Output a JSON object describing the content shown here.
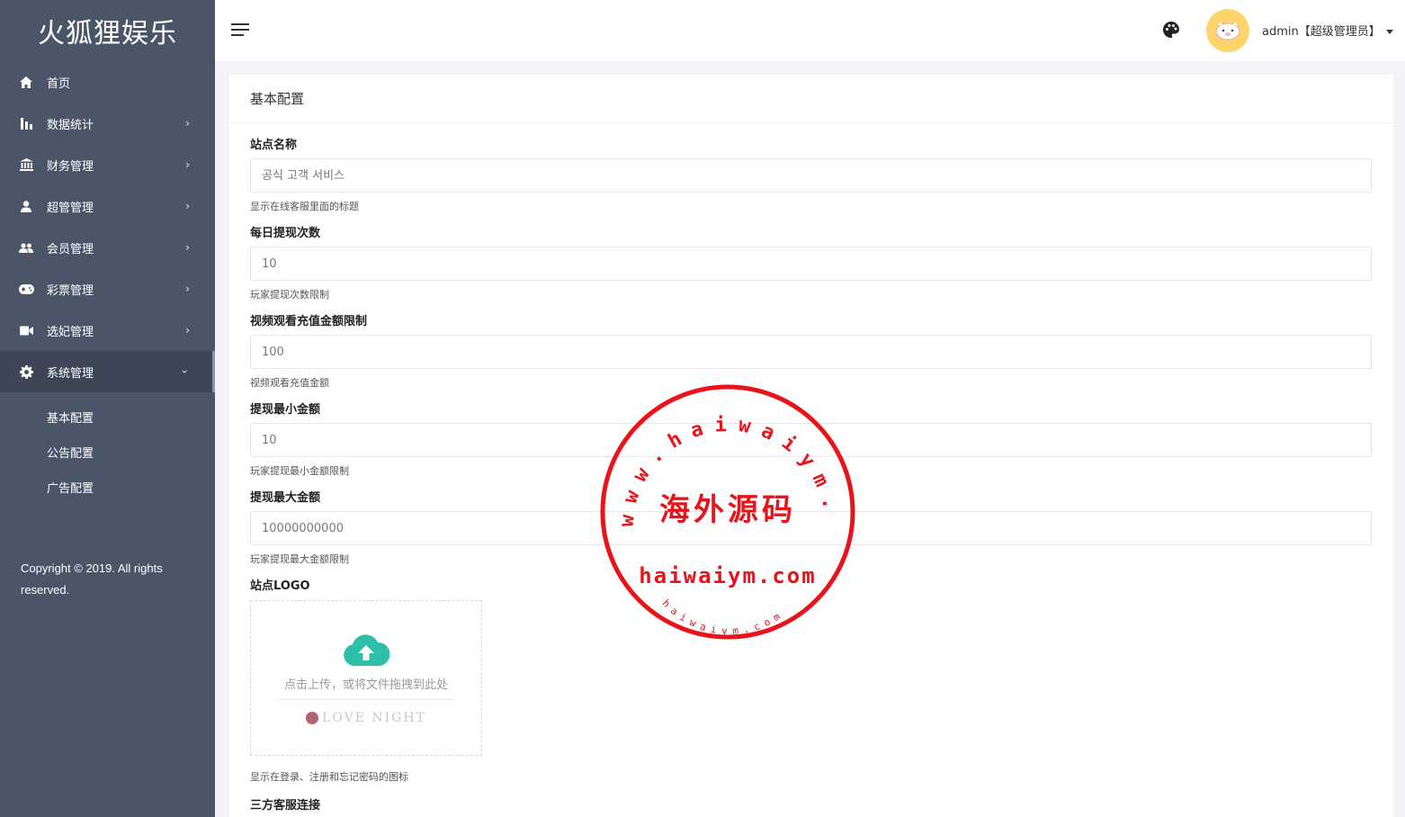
{
  "brand": {
    "title": "火狐狸娱乐"
  },
  "sidebar": {
    "items": [
      {
        "label": "首页",
        "icon": "home-icon",
        "has_children": false
      },
      {
        "label": "数据统计",
        "icon": "bar-chart-icon",
        "has_children": true
      },
      {
        "label": "财务管理",
        "icon": "bank-icon",
        "has_children": true
      },
      {
        "label": "超管管理",
        "icon": "user-icon",
        "has_children": true
      },
      {
        "label": "会员管理",
        "icon": "users-icon",
        "has_children": true
      },
      {
        "label": "彩票管理",
        "icon": "gamepad-icon",
        "has_children": true
      },
      {
        "label": "选妃管理",
        "icon": "video-camera-icon",
        "has_children": true
      },
      {
        "label": "系统管理",
        "icon": "gear-icon",
        "has_children": true,
        "expanded": true
      }
    ],
    "submenu": [
      {
        "label": "基本配置"
      },
      {
        "label": "公告配置"
      },
      {
        "label": "广告配置"
      }
    ],
    "copyright": "Copyright © 2019. All rights reserved."
  },
  "header": {
    "user_label": "admin【超级管理员】",
    "avatar_color": "#fdd36b"
  },
  "card": {
    "title": "基本配置",
    "fields": [
      {
        "label": "站点名称",
        "placeholder": "공식 고객 서비스",
        "value": "",
        "help": "显示在线客服里面的标题"
      },
      {
        "label": "每日提现次数",
        "value": "10",
        "help": "玩家提现次数限制"
      },
      {
        "label": "视频观看充值金额限制",
        "value": "100",
        "help": "视频观看充值金额"
      },
      {
        "label": "提现最小金额",
        "value": "10",
        "help": "玩家提现最小金额限制"
      },
      {
        "label": "提现最大金额",
        "value": "10000000000",
        "help": "玩家提现最大金额限制"
      }
    ],
    "logo": {
      "label": "站点LOGO",
      "upload_text": "点击上传，或将文件拖拽到此处",
      "preview_text": "LOVE NIGHT",
      "help": "显示在登录、注册和忘记密码的图标"
    },
    "next_label": "三方客服连接"
  },
  "stamp": {
    "arc_text": "www.haiwaiym.com",
    "center_text": "海外源码",
    "domain_text": "haiwaiym.com",
    "small_text": "haiwaiym.com",
    "color": "#e8141b"
  },
  "colors": {
    "sidebar": "#4a5568",
    "accent": "#2ebfa7"
  }
}
